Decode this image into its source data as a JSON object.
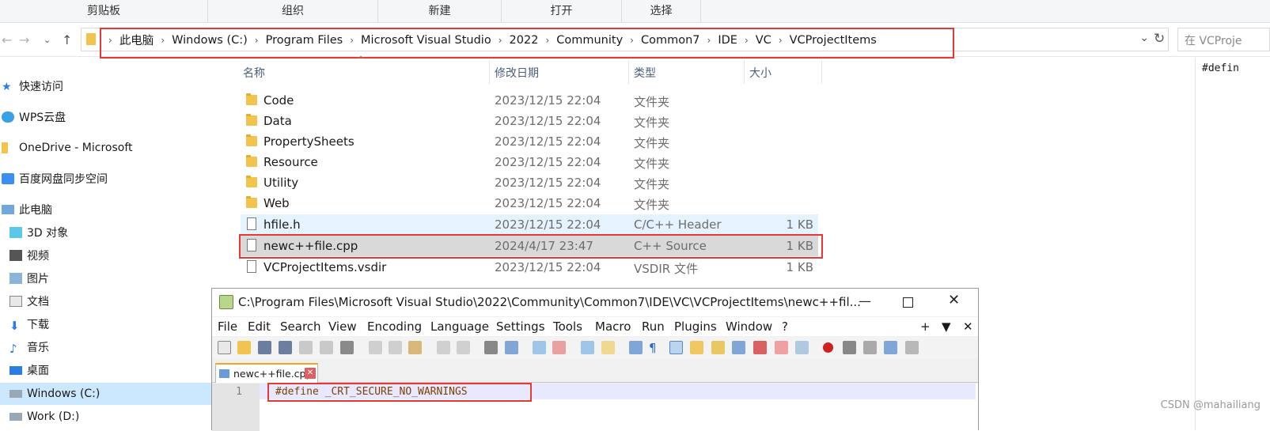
{
  "ribbon": {
    "groups": [
      "剪贴板",
      "组织",
      "新建",
      "打开",
      "选择"
    ]
  },
  "address": {
    "crumbs": [
      "此电脑",
      "Windows (C:)",
      "Program Files",
      "Microsoft Visual Studio",
      "2022",
      "Community",
      "Common7",
      "IDE",
      "VC",
      "VCProjectItems"
    ],
    "search_placeholder": "在 VCProje"
  },
  "sidebar": {
    "items": [
      {
        "label": "快速访问",
        "icon": "star-icon"
      },
      {
        "label": "WPS云盘",
        "icon": "cloud-icon"
      },
      {
        "label": "OneDrive - Microsoft",
        "icon": "folder-icon"
      },
      {
        "label": "百度网盘同步空间",
        "icon": "baidu-icon"
      },
      {
        "label": "此电脑",
        "icon": "computer-icon"
      },
      {
        "label": "3D 对象",
        "icon": "cube-icon"
      },
      {
        "label": "视频",
        "icon": "video-icon"
      },
      {
        "label": "图片",
        "icon": "picture-icon"
      },
      {
        "label": "文档",
        "icon": "document-icon"
      },
      {
        "label": "下载",
        "icon": "download-icon"
      },
      {
        "label": "音乐",
        "icon": "music-icon"
      },
      {
        "label": "桌面",
        "icon": "desktop-icon"
      },
      {
        "label": "Windows (C:)",
        "icon": "drive-icon"
      },
      {
        "label": "Work (D:)",
        "icon": "drive-icon"
      }
    ]
  },
  "columns": {
    "name": "名称",
    "date": "修改日期",
    "type": "类型",
    "size": "大小"
  },
  "files": [
    {
      "name": "Code",
      "date": "2023/12/15 22:04",
      "type": "文件夹",
      "size": ""
    },
    {
      "name": "Data",
      "date": "2023/12/15 22:04",
      "type": "文件夹",
      "size": ""
    },
    {
      "name": "PropertySheets",
      "date": "2023/12/15 22:04",
      "type": "文件夹",
      "size": ""
    },
    {
      "name": "Resource",
      "date": "2023/12/15 22:04",
      "type": "文件夹",
      "size": ""
    },
    {
      "name": "Utility",
      "date": "2023/12/15 22:04",
      "type": "文件夹",
      "size": ""
    },
    {
      "name": "Web",
      "date": "2023/12/15 22:04",
      "type": "文件夹",
      "size": ""
    },
    {
      "name": "hfile.h",
      "date": "2023/12/15 22:04",
      "type": "C/C++ Header",
      "size": "1 KB"
    },
    {
      "name": "newc++file.cpp",
      "date": "2024/4/17 23:47",
      "type": "C++ Source",
      "size": "1 KB"
    },
    {
      "name": "VCProjectItems.vsdir",
      "date": "2023/12/15 22:04",
      "type": "VSDIR 文件",
      "size": "1 KB"
    }
  ],
  "preview_text": "#defin",
  "npp": {
    "title": "C:\\Program Files\\Microsoft Visual Studio\\2022\\Community\\Common7\\IDE\\VC\\VCProjectItems\\newc++fil...",
    "menu": [
      "File",
      "Edit",
      "Search",
      "View",
      "Encoding",
      "Language",
      "Settings",
      "Tools",
      "Macro",
      "Run",
      "Plugins",
      "Window",
      "?"
    ],
    "menu_right": [
      "+",
      "▼",
      "✕"
    ],
    "tab": "newc++file.cpp",
    "line_no": "1",
    "code": "#define _CRT_SECURE_NO_WARNINGS"
  },
  "watermark": "CSDN @mahailiang"
}
